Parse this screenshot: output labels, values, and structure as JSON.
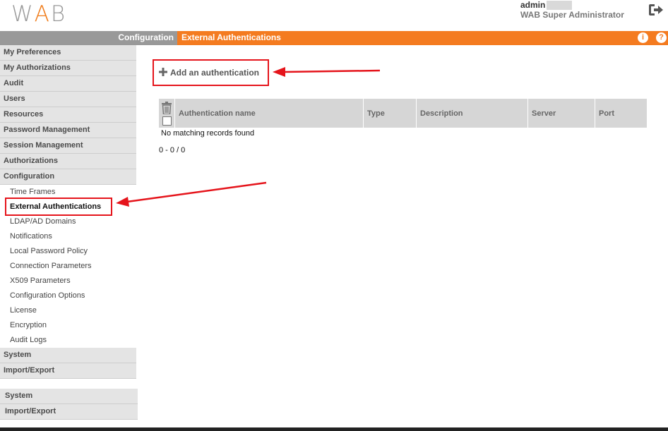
{
  "header": {
    "logo_text": "W",
    "logo_a": "A",
    "logo_b": "B",
    "user_name": "admin",
    "user_role": "WAB Super Administrator",
    "logout_icon": "logout-icon"
  },
  "topbar": {
    "section": "Configuration",
    "page": "External Authentications",
    "info_icon": "info-icon",
    "help_icon": "help-icon",
    "info_glyph": "i",
    "help_glyph": "?"
  },
  "sidebar": {
    "items": [
      {
        "label": "My Preferences"
      },
      {
        "label": "My Authorizations"
      },
      {
        "label": "Audit"
      },
      {
        "label": "Users"
      },
      {
        "label": "Resources"
      },
      {
        "label": "Password Management"
      },
      {
        "label": "Session Management"
      },
      {
        "label": "Authorizations"
      },
      {
        "label": "Configuration"
      }
    ],
    "sub_items": [
      {
        "label": "Time Frames"
      },
      {
        "label": "External Authentications"
      },
      {
        "label": "LDAP/AD Domains"
      },
      {
        "label": "Notifications"
      },
      {
        "label": "Local Password Policy"
      },
      {
        "label": "Connection Parameters"
      },
      {
        "label": "X509 Parameters"
      },
      {
        "label": "Configuration Options"
      },
      {
        "label": "License"
      },
      {
        "label": "Encryption"
      },
      {
        "label": "Audit Logs"
      }
    ],
    "after_items": [
      {
        "label": "System"
      },
      {
        "label": "Import/Export"
      }
    ],
    "secondary_items": [
      {
        "label": "System"
      },
      {
        "label": "Import/Export"
      }
    ]
  },
  "main": {
    "add_label": "Add an authentication",
    "table": {
      "columns": [
        "Authentication name",
        "Type",
        "Description",
        "Server",
        "Port"
      ]
    },
    "empty_message": "No matching records found",
    "pager": "0 - 0 / 0"
  },
  "colors": {
    "accent": "#f47b20",
    "highlight": "#e5141b"
  }
}
